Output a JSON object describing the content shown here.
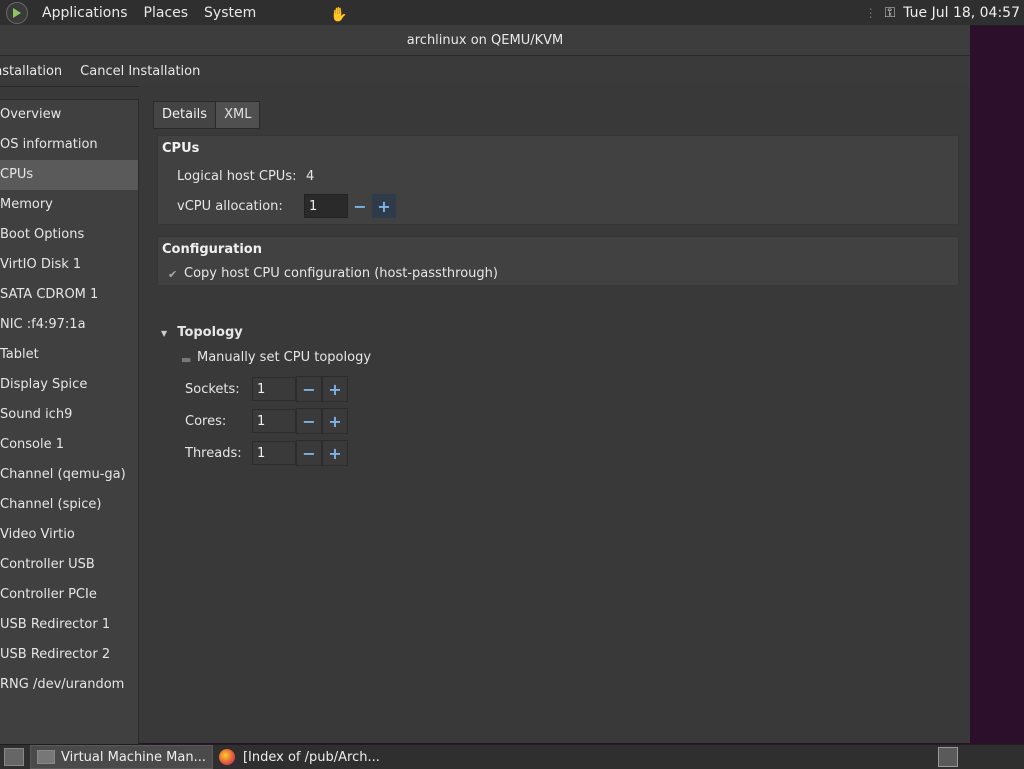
{
  "panel": {
    "menus": [
      "Applications",
      "Places",
      "System"
    ],
    "clock": "Tue Jul 18, 04:57"
  },
  "window": {
    "title": "archlinux on QEMU/KVM",
    "toolbar": [
      "nstallation",
      "Cancel Installation"
    ]
  },
  "sidebar": {
    "items": [
      "Overview",
      "OS information",
      "CPUs",
      "Memory",
      "Boot Options",
      "VirtIO Disk 1",
      "SATA CDROM 1",
      "NIC :f4:97:1a",
      "Tablet",
      "Display Spice",
      "Sound ich9",
      "Console 1",
      "Channel (qemu-ga)",
      "Channel (spice)",
      "Video Virtio",
      "Controller USB",
      "Controller PCIe",
      "USB Redirector 1",
      "USB Redirector 2",
      "RNG /dev/urandom"
    ],
    "selected": "CPUs"
  },
  "tabs": {
    "details": "Details",
    "xml": "XML"
  },
  "cpus": {
    "title": "CPUs",
    "logical_label": "Logical host CPUs:",
    "logical_value": "4",
    "vcpu_label": "vCPU allocation:",
    "vcpu_value": "1"
  },
  "configuration": {
    "title": "Configuration",
    "copy_label": "Copy host CPU configuration (host-passthrough)"
  },
  "topology": {
    "title": "Topology",
    "manual_label": "Manually set CPU topology",
    "sockets_label": "Sockets:",
    "sockets_value": "1",
    "cores_label": "Cores:",
    "cores_value": "1",
    "threads_label": "Threads:",
    "threads_value": "1"
  },
  "spin": {
    "minus": "−",
    "plus": "+"
  },
  "taskbar": {
    "tasks": [
      "Virtual Machine Man...",
      "[Index of /pub/Arch..."
    ]
  }
}
